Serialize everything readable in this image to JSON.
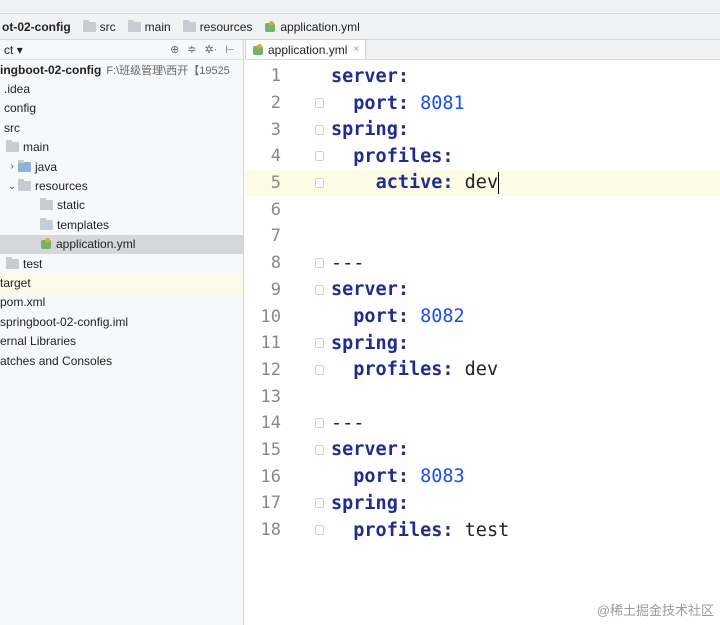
{
  "breadcrumb": {
    "project": "ot-02-config",
    "items": [
      "src",
      "main",
      "resources",
      "application.yml"
    ]
  },
  "project_panel": {
    "title": "ct",
    "title_arrow": "▾",
    "toolbar_icons": [
      "settings-icon",
      "collapse-icon",
      "gear-icon",
      "hide-icon"
    ],
    "tree": [
      {
        "label": "ingboot-02-config",
        "path": "F:\\班级管理\\西开【19525",
        "bold": true,
        "arrow": "",
        "icon": "module-folder"
      },
      {
        "label": ".idea",
        "arrow": "",
        "icon": ""
      },
      {
        "label": "config",
        "arrow": "",
        "icon": ""
      },
      {
        "label": "src",
        "arrow": "",
        "icon": ""
      },
      {
        "label": "main",
        "arrow": "",
        "icon": "folder"
      },
      {
        "label": "java",
        "arrow": "›",
        "icon": "folder-blue"
      },
      {
        "label": "resources",
        "arrow": "⌄",
        "icon": "folder"
      },
      {
        "label": "static",
        "arrow": "",
        "icon": "folder"
      },
      {
        "label": "templates",
        "arrow": "",
        "icon": "folder"
      },
      {
        "label": "application.yml",
        "arrow": "",
        "icon": "yml",
        "selected": true
      },
      {
        "label": "test",
        "arrow": "",
        "icon": "folder"
      },
      {
        "label": "target",
        "arrow": "",
        "icon": "",
        "highlight": true
      },
      {
        "label": "pom.xml",
        "arrow": "",
        "icon": ""
      },
      {
        "label": "springboot-02-config.iml",
        "arrow": "",
        "icon": ""
      },
      {
        "label": "ernal Libraries",
        "arrow": "",
        "icon": ""
      },
      {
        "label": "atches and Consoles",
        "arrow": "",
        "icon": ""
      }
    ]
  },
  "editor": {
    "tab_label": "application.yml",
    "tab_close": "×",
    "current_line": 5,
    "lines": [
      {
        "n": "1",
        "indent": "",
        "key": "server:",
        "val": ""
      },
      {
        "n": "2",
        "indent": "  ",
        "key": "port: ",
        "val": "8081"
      },
      {
        "n": "3",
        "indent": "",
        "key": "spring:",
        "val": ""
      },
      {
        "n": "4",
        "indent": "  ",
        "key": "profiles:",
        "val": ""
      },
      {
        "n": "5",
        "indent": "    ",
        "key": "active: ",
        "val": "dev",
        "plain": true
      },
      {
        "n": "6",
        "indent": "",
        "key": "",
        "val": ""
      },
      {
        "n": "7",
        "indent": "",
        "key": "",
        "val": ""
      },
      {
        "n": "8",
        "indent": "",
        "key": "",
        "val": "---",
        "plain": true
      },
      {
        "n": "9",
        "indent": "",
        "key": "server:",
        "val": ""
      },
      {
        "n": "10",
        "indent": "  ",
        "key": "port: ",
        "val": "8082"
      },
      {
        "n": "11",
        "indent": "",
        "key": "spring:",
        "val": ""
      },
      {
        "n": "12",
        "indent": "  ",
        "key": "profiles: ",
        "val": "dev",
        "plain": true
      },
      {
        "n": "13",
        "indent": "",
        "key": "",
        "val": ""
      },
      {
        "n": "14",
        "indent": "",
        "key": "",
        "val": "---",
        "plain": true
      },
      {
        "n": "15",
        "indent": "",
        "key": "server:",
        "val": ""
      },
      {
        "n": "16",
        "indent": "  ",
        "key": "port: ",
        "val": "8083"
      },
      {
        "n": "17",
        "indent": "",
        "key": "spring:",
        "val": ""
      },
      {
        "n": "18",
        "indent": "  ",
        "key": "profiles: ",
        "val": "test",
        "plain": true
      }
    ]
  },
  "watermark": "@稀土掘金技术社区"
}
